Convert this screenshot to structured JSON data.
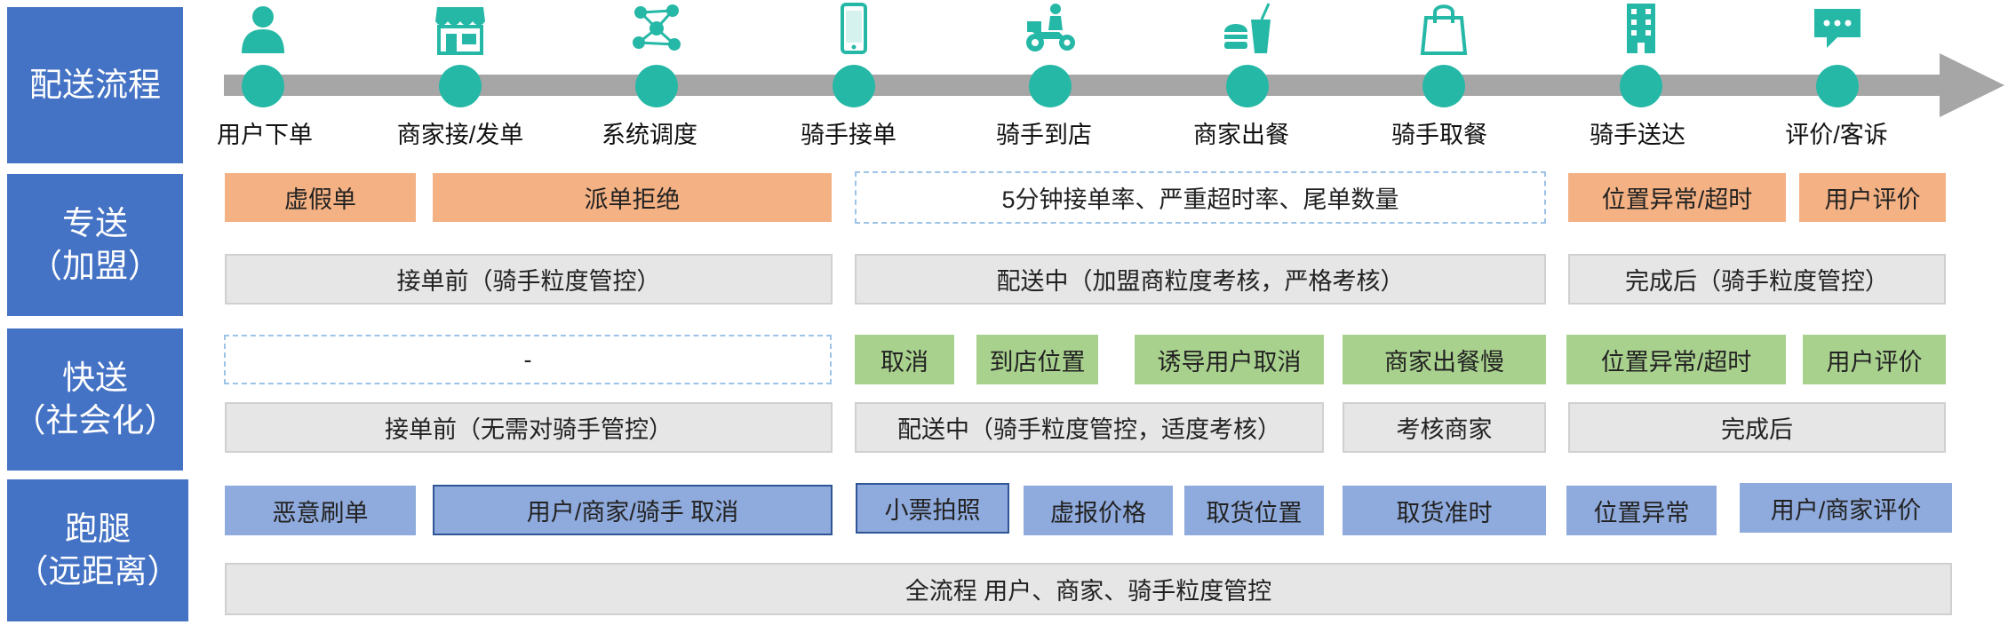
{
  "rows": [
    {
      "label": "配送流程"
    },
    {
      "label": "专送\n（加盟）"
    },
    {
      "label": "快送\n（社会化）"
    },
    {
      "label": "跑腿\n（远距离）"
    }
  ],
  "stages": [
    {
      "label": "用户下单",
      "icon": "user-icon"
    },
    {
      "label": "商家接/发单",
      "icon": "store-icon"
    },
    {
      "label": "系统调度",
      "icon": "network-icon"
    },
    {
      "label": "骑手接单",
      "icon": "phone-icon"
    },
    {
      "label": "骑手到店",
      "icon": "motorbike-icon"
    },
    {
      "label": "商家出餐",
      "icon": "burger-drink-icon"
    },
    {
      "label": "骑手取餐",
      "icon": "shopping-bag-icon"
    },
    {
      "label": "骑手送达",
      "icon": "building-icon"
    },
    {
      "label": "评价/客诉",
      "icon": "chat-icon"
    }
  ],
  "zhuansong": {
    "top": [
      "虚假单",
      "派单拒绝",
      "5分钟接单率、严重超时率、尾单数量",
      "位置异常/超时",
      "用户评价"
    ],
    "bottom": [
      "接单前（骑手粒度管控）",
      "配送中（加盟商粒度考核，严格考核）",
      "完成后（骑手粒度管控）"
    ]
  },
  "kuaisong": {
    "top": [
      "-",
      "取消",
      "到店位置",
      "诱导用户取消",
      "商家出餐慢",
      "位置异常/超时",
      "用户评价"
    ],
    "bottom": [
      "接单前（无需对骑手管控）",
      "配送中（骑手粒度管控，适度考核）",
      "考核商家",
      "完成后"
    ]
  },
  "paotui": {
    "top": [
      "恶意刷单",
      "用户/商家/骑手 取消",
      "小票拍照",
      "虚报价格",
      "取货位置",
      "取货准时",
      "位置异常",
      "用户/商家评价"
    ],
    "bottom": [
      "全流程 用户、商家、骑手粒度管控"
    ]
  },
  "colors": {
    "label_bg": "#4472c4",
    "orange": "#f4b183",
    "gray": "#e7e6e6",
    "green": "#a9d18e",
    "blue": "#8faadc",
    "teal": "#26b8a6",
    "arrow": "#a6a6a6"
  }
}
